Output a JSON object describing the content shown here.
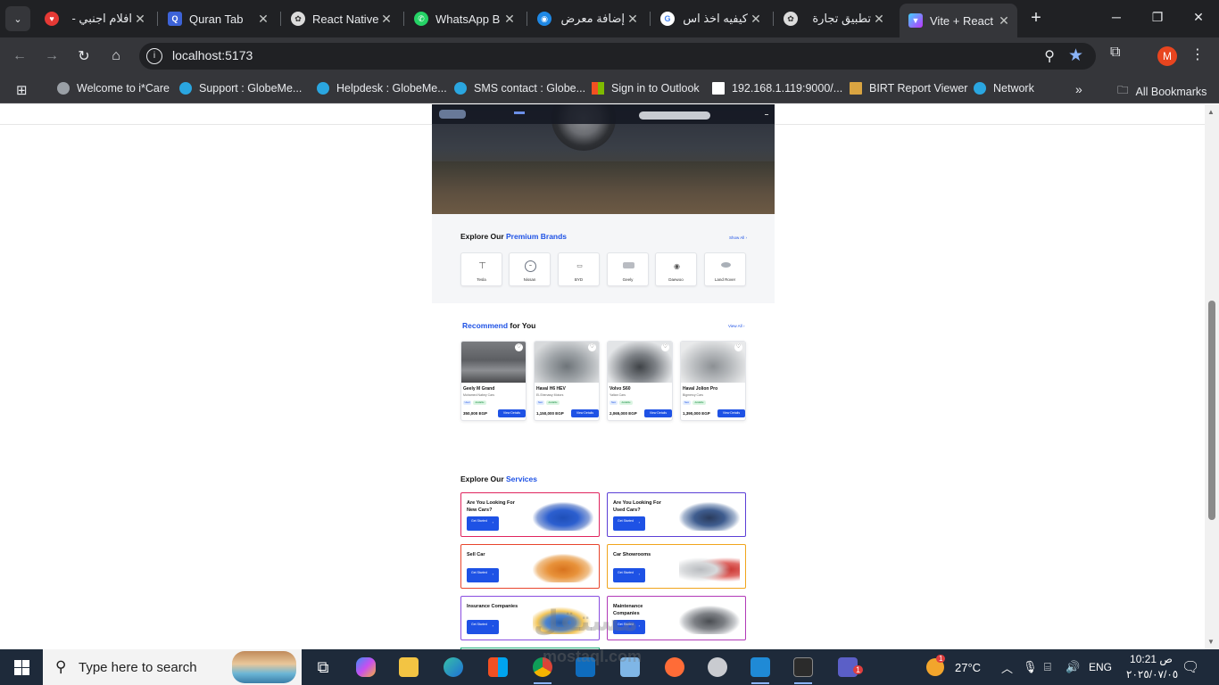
{
  "browser": {
    "tabs": [
      {
        "title": "افلام اجنبي -",
        "favicon": "red-heart-favicon",
        "color": "#e53935"
      },
      {
        "title": "Quran Tab",
        "favicon": "quran-favicon",
        "color": "#3d63d8"
      },
      {
        "title": "React Native",
        "favicon": "openai-favicon",
        "color": "#dcdcdc"
      },
      {
        "title": "WhatsApp B",
        "favicon": "whatsapp-favicon",
        "color": "#25d366"
      },
      {
        "title": "إضافة معرض",
        "favicon": "circle-favicon",
        "color": "#1e88e5"
      },
      {
        "title": "كيفيه اخذ اس",
        "favicon": "google-favicon",
        "color": "#ffffff"
      },
      {
        "title": "تطبيق تجارة",
        "favicon": "openai-favicon",
        "color": "#dcdcdc"
      },
      {
        "title": "Vite + React",
        "favicon": "vite-favicon",
        "color": "#a259ff",
        "active": true
      }
    ],
    "url": "localhost:5173",
    "profile_initial": "M",
    "bookmarks": [
      {
        "label": "Welcome to i*Care",
        "icon": "globe-icon"
      },
      {
        "label": "Support : GlobeMe...",
        "icon": "edge-icon"
      },
      {
        "label": "Helpdesk : GlobeMe...",
        "icon": "edge-icon"
      },
      {
        "label": "SMS contact : Globe...",
        "icon": "edge-icon"
      },
      {
        "label": "Sign in to Outlook",
        "icon": "microsoft-icon"
      },
      {
        "label": "192.168.1.119:9000/...",
        "icon": "page-icon"
      },
      {
        "label": "BIRT Report Viewer",
        "icon": "birt-icon"
      },
      {
        "label": "Network",
        "icon": "edge-icon"
      }
    ],
    "all_bookmarks": "All Bookmarks"
  },
  "page": {
    "brands": {
      "title_prefix": "Explore Our ",
      "title_highlight": "Premium Brands",
      "view_all": "Show All",
      "items": [
        "Tesla",
        "Nissan",
        "BYD",
        "Geely",
        "Daewoo",
        "Land Rover"
      ]
    },
    "recommend": {
      "title_highlight": "Recommend",
      "title_suffix": " for You",
      "view_all": "View All",
      "cars": [
        {
          "name": "Geely M Grand",
          "dealer": "Mohamed Nabey Cars",
          "price": "350,000 EGP",
          "button": "View Details",
          "tags": [
            "Used",
            "Available"
          ]
        },
        {
          "name": "Haval H6 HEV",
          "dealer": "El-Shenawy Motors",
          "price": "1,150,000 EGP",
          "button": "View Details",
          "tags": [
            "New",
            "Available"
          ]
        },
        {
          "name": "Volvo S60",
          "dealer": "Yaltan Cars",
          "price": "2,065,000 EGP",
          "button": "View Details",
          "tags": [
            "New",
            "Available"
          ]
        },
        {
          "name": "Haval Jolion Pro",
          "dealer": "Bigmercy Cars",
          "price": "1,390,000 EGP",
          "button": "View Details",
          "tags": [
            "New",
            "Available"
          ]
        }
      ]
    },
    "services": {
      "title_prefix": "Explore Our ",
      "title_highlight": "Services",
      "button": "Get Started",
      "items": [
        {
          "title": "Are You Looking For New Cars?",
          "border": "#e0245e"
        },
        {
          "title": "Are You Looking For Used Cars?",
          "border": "#5b3fd6"
        },
        {
          "title": "Sell Car",
          "border": "#e8452c"
        },
        {
          "title": "Car Showrooms",
          "border": "#f0a51c"
        },
        {
          "title": "Insurance Companies",
          "border": "#8a4de0"
        },
        {
          "title": "Maintenance Companies",
          "border": "#b23ab8"
        }
      ]
    },
    "watermark": "مستقل",
    "watermark_latin": "mostaql.com"
  },
  "taskbar": {
    "search_placeholder": "Type here to search",
    "weather": "27°C",
    "language": "ENG",
    "time": "10:21",
    "am_pm": "ص",
    "date": "٢٠٢٥/٠٧/٠٥",
    "weather_badge": "1",
    "teams_badge": "1"
  },
  "colors": {
    "accent": "#1e52e5",
    "chrome_dark": "#202124",
    "chrome_toolbar": "#35363a"
  }
}
